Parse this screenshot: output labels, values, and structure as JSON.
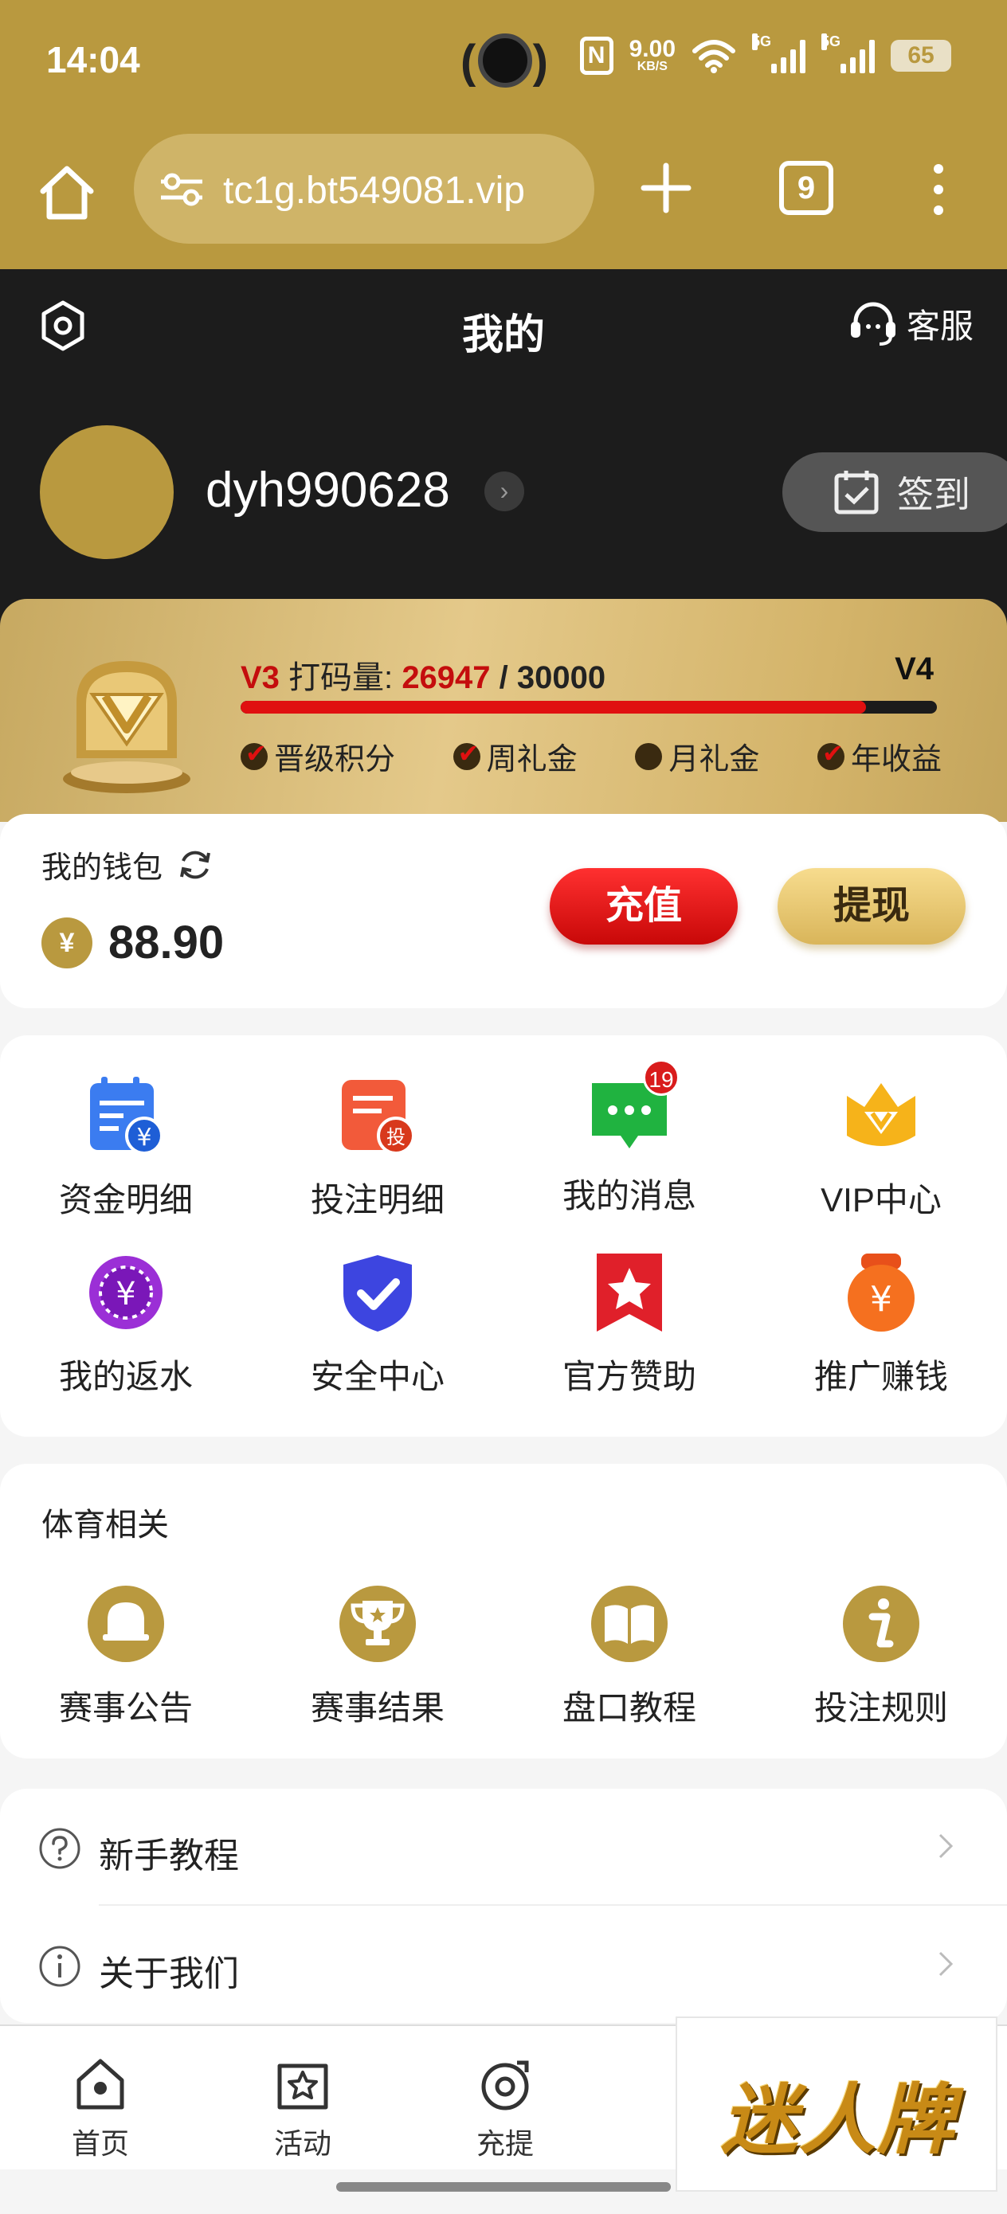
{
  "status_bar": {
    "time": "14:04",
    "speed_value": "9.00",
    "speed_unit": "KB/S",
    "network_1": "5G",
    "network_2": "5G",
    "battery": "65"
  },
  "browser": {
    "url": "tc1g.bt549081.vip",
    "tab_count": "9"
  },
  "header": {
    "title": "我的",
    "service_label": "客服"
  },
  "user": {
    "username": "dyh990628",
    "checkin_label": "签到"
  },
  "vip": {
    "current_level": "V3",
    "progress_label": "打码量:",
    "current_points": "26947",
    "separator": "/",
    "target_points": "30000",
    "next_level": "V4",
    "progress_fraction": 0.898,
    "perks": [
      {
        "label": "晋级积分",
        "active": true
      },
      {
        "label": "周礼金",
        "active": true
      },
      {
        "label": "月礼金",
        "active": false
      },
      {
        "label": "年收益",
        "active": true
      }
    ]
  },
  "wallet": {
    "label": "我的钱包",
    "currency_symbol": "¥",
    "balance": "88.90",
    "deposit_label": "充值",
    "withdraw_label": "提现"
  },
  "features": [
    {
      "label": "资金明细",
      "icon": "fund-details-icon"
    },
    {
      "label": "投注明细",
      "icon": "bet-details-icon"
    },
    {
      "label": "我的消息",
      "icon": "message-icon",
      "badge": "19"
    },
    {
      "label": "VIP中心",
      "icon": "vip-crown-icon"
    },
    {
      "label": "我的返水",
      "icon": "rebate-icon"
    },
    {
      "label": "安全中心",
      "icon": "security-shield-icon"
    },
    {
      "label": "官方赞助",
      "icon": "sponsor-star-icon"
    },
    {
      "label": "推广赚钱",
      "icon": "promote-earn-icon"
    }
  ],
  "sports": {
    "title": "体育相关",
    "items": [
      {
        "label": "赛事公告",
        "icon": "bell-icon"
      },
      {
        "label": "赛事结果",
        "icon": "trophy-icon"
      },
      {
        "label": "盘口教程",
        "icon": "book-icon"
      },
      {
        "label": "投注规则",
        "icon": "info-icon"
      }
    ]
  },
  "list": [
    {
      "label": "新手教程",
      "icon": "question-icon"
    },
    {
      "label": "关于我们",
      "icon": "info-circle-icon"
    }
  ],
  "bottom_nav": [
    {
      "label": "首页",
      "icon": "home-nav-icon"
    },
    {
      "label": "活动",
      "icon": "activity-nav-icon"
    },
    {
      "label": "充提",
      "icon": "deposit-nav-icon"
    }
  ],
  "logo_text": "迷人牌",
  "colors": {
    "gold": "#b9993f",
    "red": "#e01010",
    "dark": "#1c1c1c"
  }
}
